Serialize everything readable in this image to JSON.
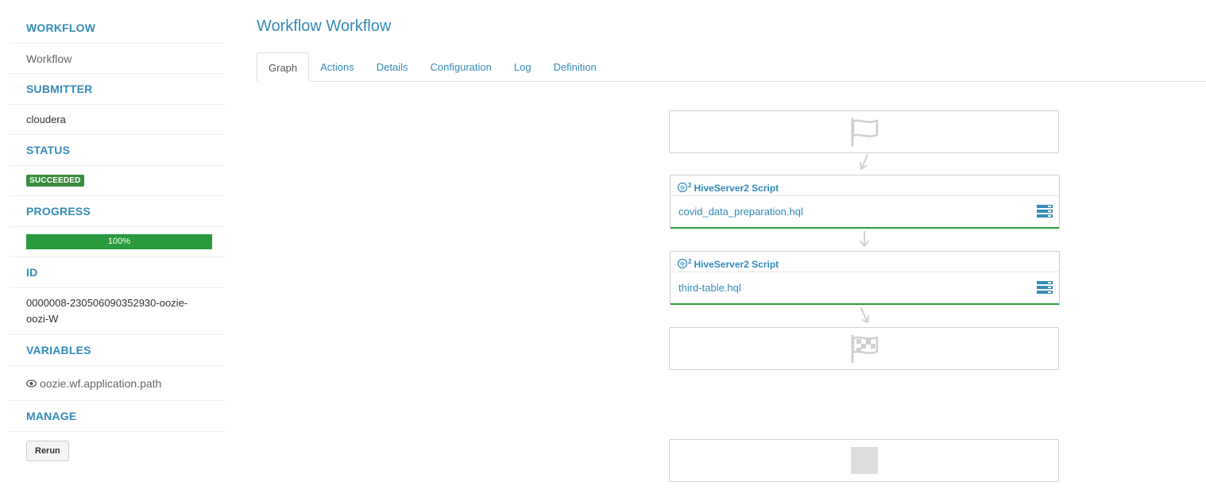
{
  "sidebar": {
    "workflow_heading": "WORKFLOW",
    "workflow_link": "Workflow",
    "submitter_heading": "SUBMITTER",
    "submitter_value": "cloudera",
    "status_heading": "STATUS",
    "status_badge": "SUCCEEDED",
    "progress_heading": "PROGRESS",
    "progress_percent": 100,
    "progress_text": "100%",
    "id_heading": "ID",
    "id_value": "0000008-230506090352930-oozie-oozi-W",
    "variables_heading": "VARIABLES",
    "variable_item": "oozie.wf.application.path",
    "manage_heading": "MANAGE",
    "rerun_label": "Rerun"
  },
  "main": {
    "title": "Workflow Workflow",
    "tabs": [
      "Graph",
      "Actions",
      "Details",
      "Configuration",
      "Log",
      "Definition"
    ],
    "active_tab": "Graph"
  },
  "graph": {
    "actions": [
      {
        "type": "HiveServer2 Script",
        "sup": "2",
        "script": "covid_data_preparation.hql"
      },
      {
        "type": "HiveServer2 Script",
        "sup": "2",
        "script": "third-table.hql"
      }
    ]
  },
  "colors": {
    "accent": "#338bb8",
    "success": "#3a8b3d",
    "progress": "#299a3e"
  }
}
